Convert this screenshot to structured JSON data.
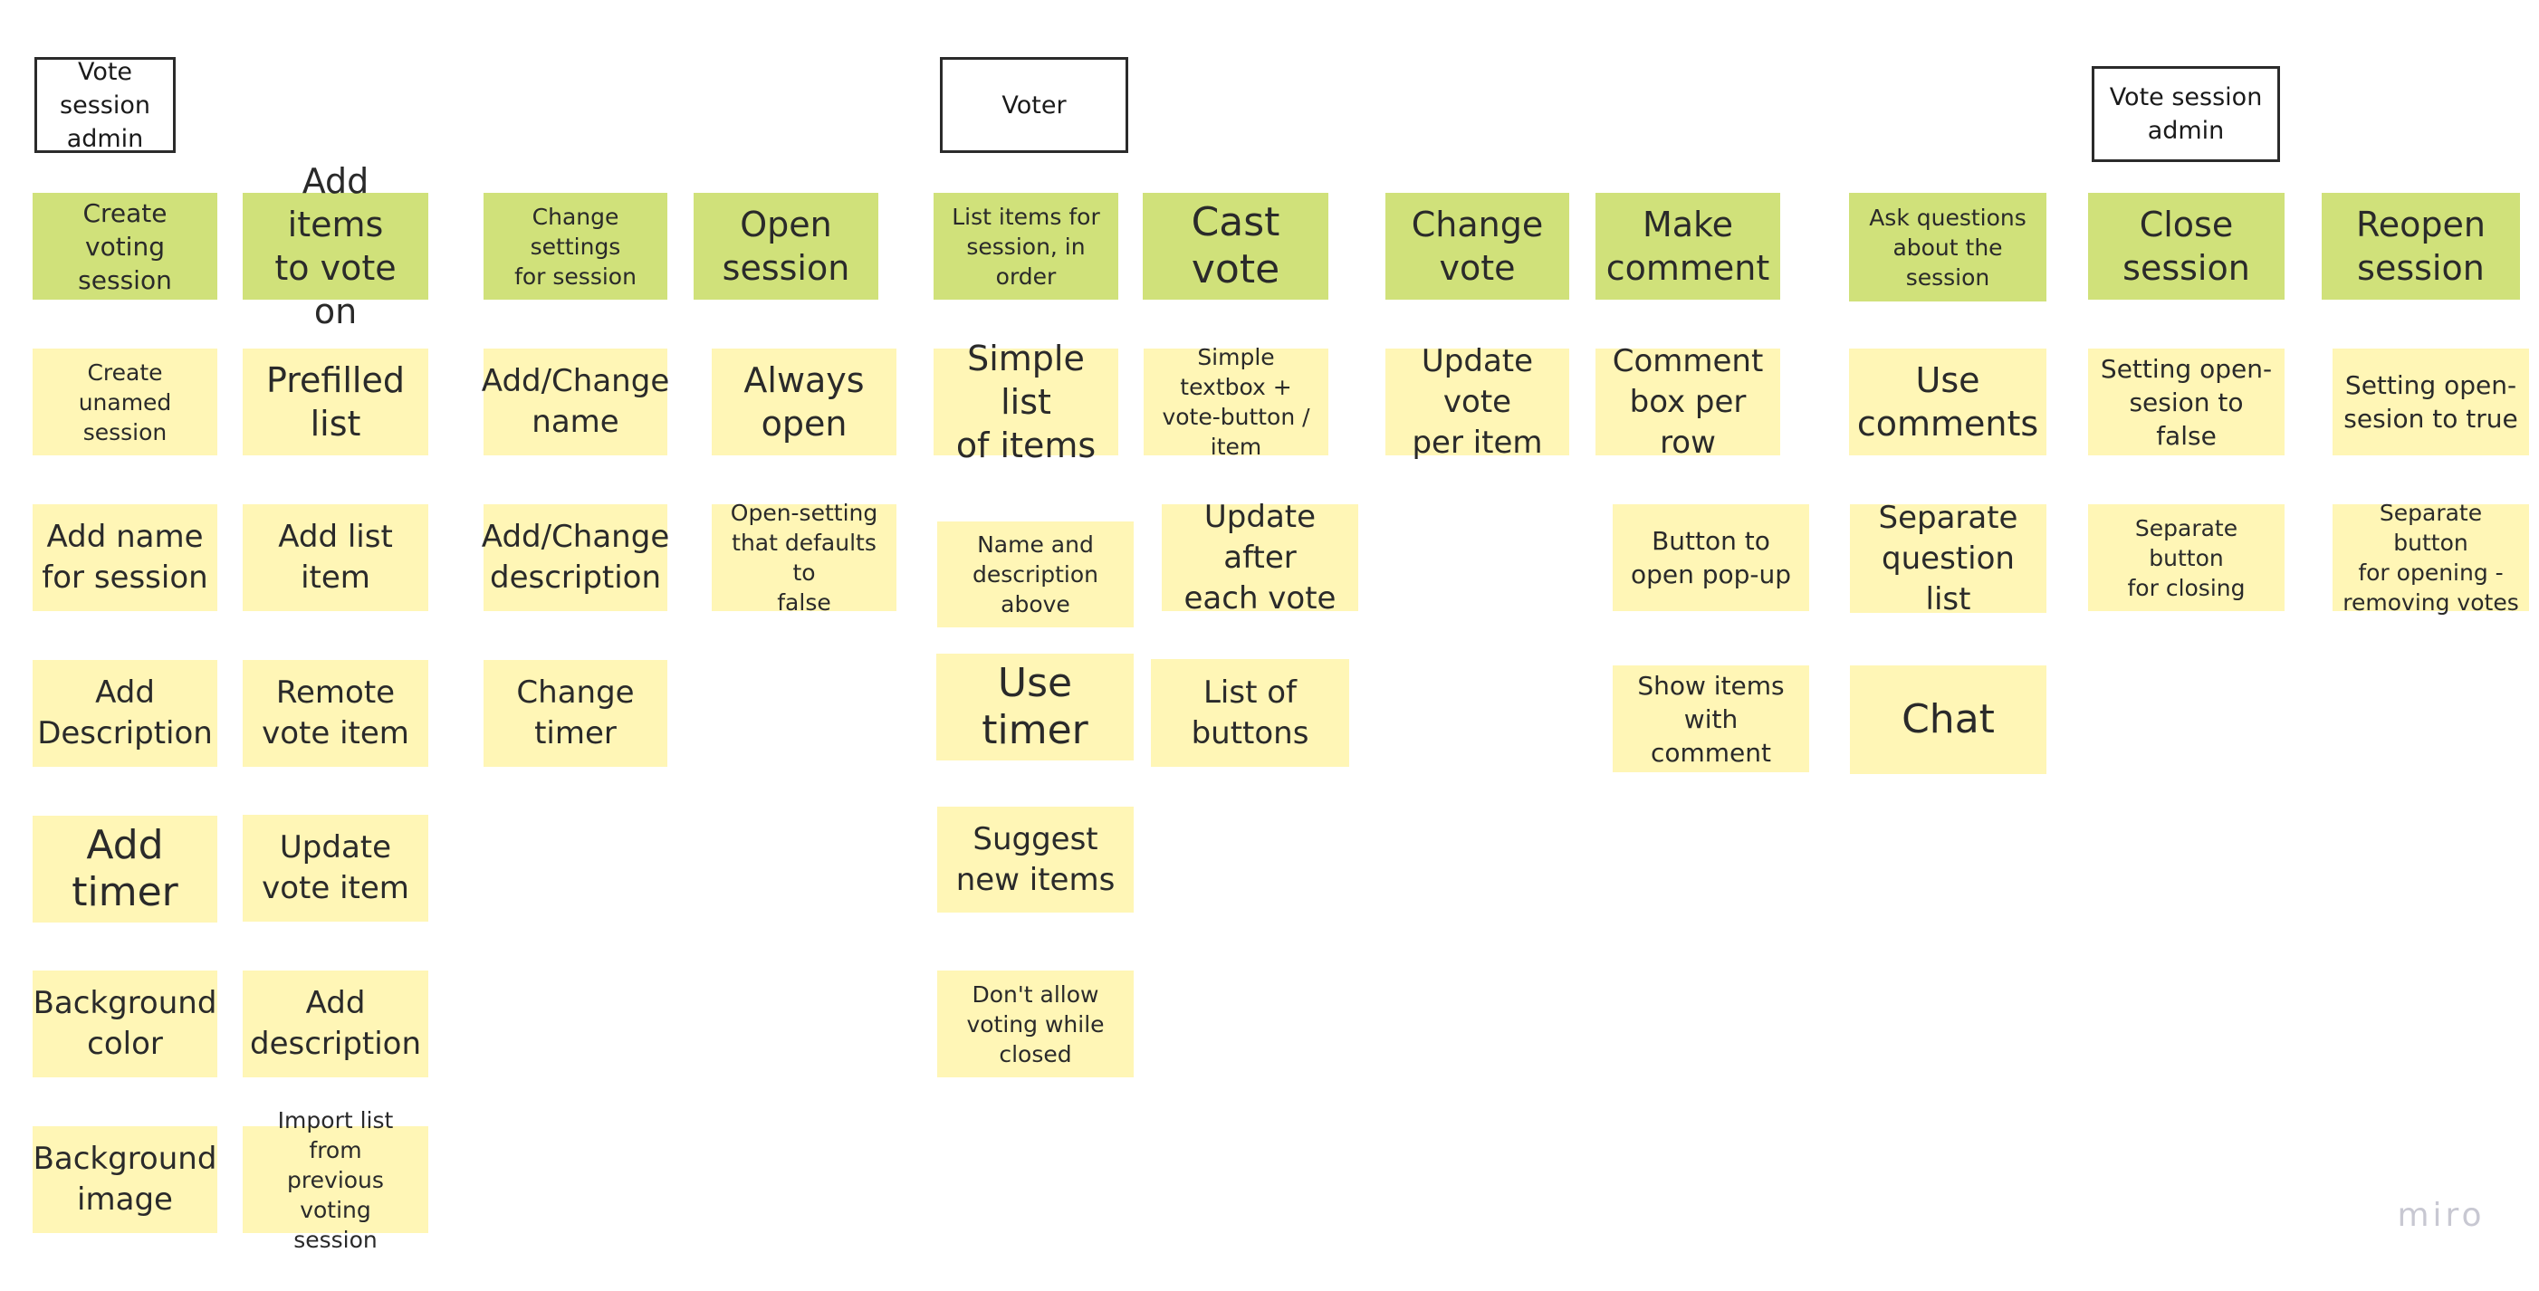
{
  "board": {
    "app": "miro",
    "colors": {
      "epic_sticky": "#d0e17a",
      "story_sticky": "#fff6b6",
      "frame_border": "#2b2b2b",
      "logo": "#c8c8d2"
    }
  },
  "headers": [
    {
      "label": "Vote session\nadmin"
    },
    {
      "label": "Voter"
    },
    {
      "label": "Vote session\nadmin"
    }
  ],
  "columns": [
    {
      "epic": "Create voting\nsession",
      "stories": [
        "Create unamed\nsession",
        "Add name\nfor session",
        "Add\nDescription",
        "Add timer",
        "Background\ncolor",
        "Background\nimage"
      ]
    },
    {
      "epic": "Add items\nto vote on",
      "stories": [
        "Prefilled list",
        "Add list\nitem",
        "Remote\nvote item",
        "Update\nvote item",
        "Add\ndescription",
        "Import list from\nprevious voting\nsession"
      ]
    },
    {
      "epic": "Change settings\nfor session",
      "stories": [
        "Add/Change\nname",
        "Add/Change\ndescription",
        "Change\ntimer"
      ]
    },
    {
      "epic": "Open\nsession",
      "stories": [
        "Always\nopen",
        "Open-setting\nthat defaults to\nfalse"
      ]
    },
    {
      "epic": "List items for\nsession, in  order",
      "stories": [
        "Simple list\nof items",
        "Name and\ndescription\nabove",
        "Use timer",
        "Suggest\nnew items",
        "Don't allow\nvoting while\nclosed"
      ]
    },
    {
      "epic": "Cast vote",
      "stories": [
        "Simple textbox +\nvote-button /\nitem",
        "Update after\neach vote",
        "List of\nbuttons"
      ]
    },
    {
      "epic": "Change\nvote",
      "stories": [
        "Update vote\nper item"
      ]
    },
    {
      "epic": "Make\ncomment",
      "stories": [
        "Comment\nbox per row",
        "Button to\nopen pop-up",
        "Show items\nwith comment"
      ]
    },
    {
      "epic": "Ask questions\nabout the\nsession",
      "stories": [
        "Use\ncomments",
        "Separate\nquestion list",
        "Chat"
      ]
    },
    {
      "epic": "Close\nsession",
      "stories": [
        "Setting open-\nsesion to false",
        "Separate button\nfor closing"
      ]
    },
    {
      "epic": "Reopen\nsession",
      "stories": [
        "Setting open-\nsesion to true",
        "Separate button\nfor opening -\nremoving votes"
      ]
    }
  ]
}
